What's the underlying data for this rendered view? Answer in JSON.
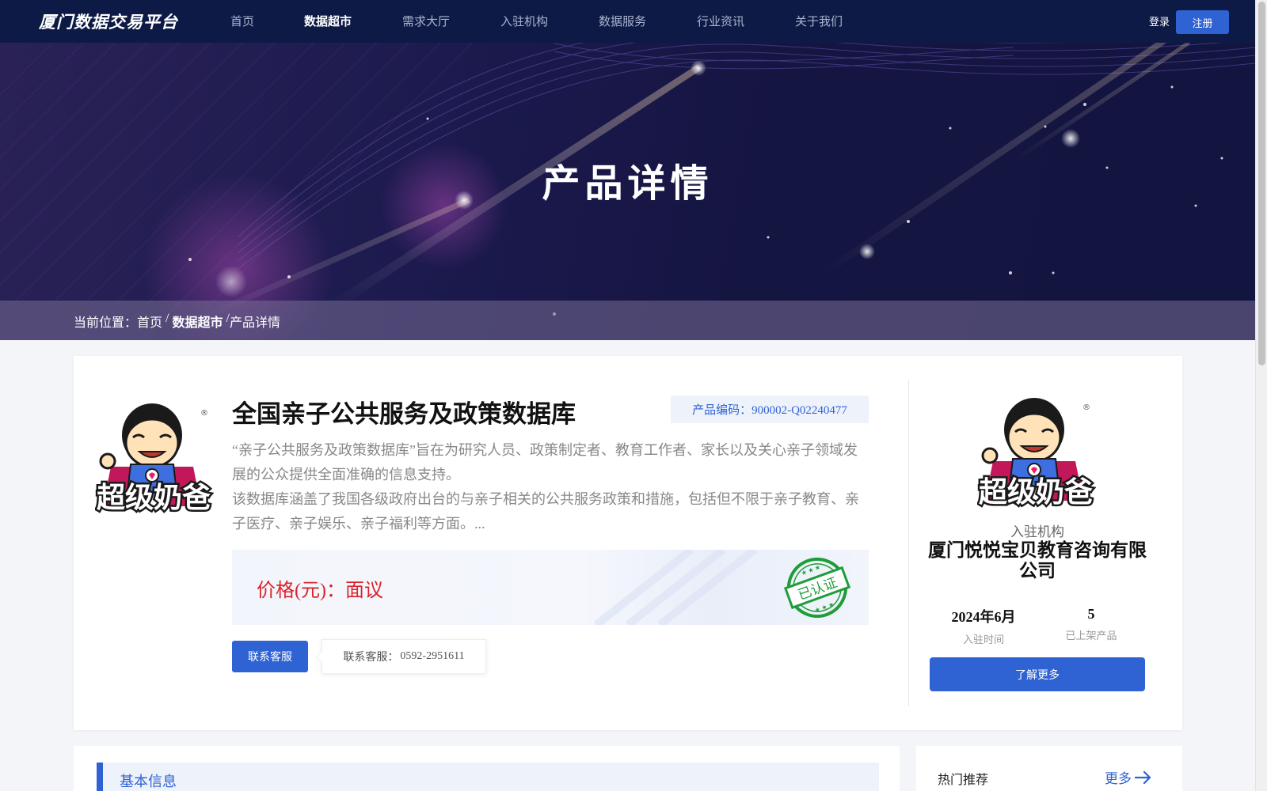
{
  "header": {
    "logo": "厦门数据交易平台",
    "nav": [
      "首页",
      "数据超市",
      "需求大厅",
      "入驻机构",
      "数据服务",
      "行业资讯",
      "关于我们"
    ],
    "active_index": 1,
    "login": "登录",
    "register": "注册"
  },
  "banner": {
    "title": "产品详情",
    "breadcrumb": {
      "prefix": "当前位置：",
      "home": "首页",
      "sep1": "/",
      "section": "数据超市",
      "sep2": "/",
      "current": "产品详情"
    }
  },
  "product": {
    "logo_text": "超级奶爸",
    "logo_mark": "®",
    "title": "全国亲子公共服务及政策数据库",
    "code": "产品编码：900002-Q02240477",
    "description_1": "“亲子公共服务及政策数据库”旨在为研究人员、政策制定者、教育工作者、家长以及关心亲子领域发展的公众提供全面准确的信息支持。",
    "description_2": "该数据库涵盖了我国各级政府出台的与亲子相关的公共服务政策和措施，包括但不限于亲子教育、亲子医疗、亲子娱乐、亲子福利等方面。...",
    "price": "价格(元)：面议",
    "stamp_text": "已认证",
    "contact_button": "联系客服",
    "contact_label": "联系客服：",
    "contact_phone": "0592-2951611"
  },
  "org": {
    "logo_text": "超级奶爸",
    "logo_mark": "®",
    "label": "入驻机构",
    "name": "厦门悦悦宝贝教育咨询有限公司",
    "join_date": "2024年6月",
    "join_label": "入驻时间",
    "product_count": "5",
    "product_label": "已上架产品",
    "more_button": "了解更多"
  },
  "basic": {
    "title": "基本信息"
  },
  "hot": {
    "title": "热门推荐",
    "more": "更多"
  },
  "colors": {
    "primary": "#2f63d4",
    "price": "#d9232a",
    "stamp": "#1f9c3a",
    "nav_bg": "#0d1a46"
  }
}
